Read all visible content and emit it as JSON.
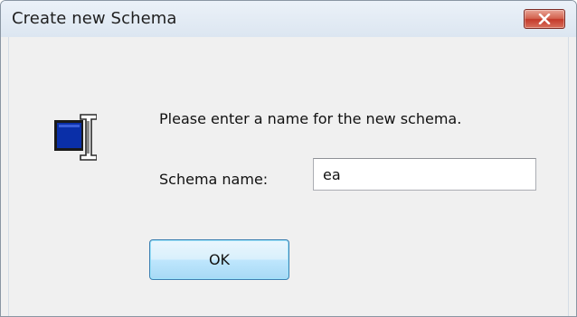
{
  "dialog": {
    "title": "Create new Schema",
    "close_icon": "close-x-icon",
    "app_icon": "schema-rename-icon",
    "prompt": "Please enter a name for the new schema.",
    "name_label": "Schema name:",
    "name_value": "ea",
    "ok_label": "OK"
  },
  "colors": {
    "close_button": "#c3392a",
    "ok_button_border": "#3c7fb1",
    "icon_blue": "#0a2fa8"
  }
}
